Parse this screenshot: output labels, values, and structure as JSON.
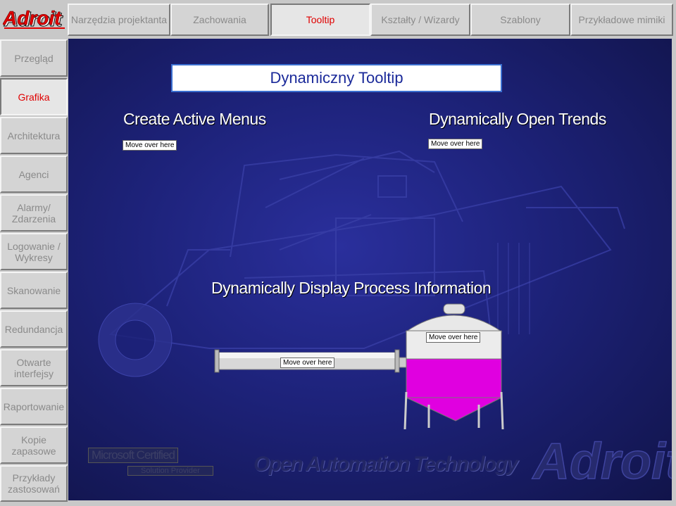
{
  "brand": {
    "logo_text": "Adroit"
  },
  "top_tabs": [
    {
      "label": "Narzędzia projektanta",
      "active": false
    },
    {
      "label": "Zachowania",
      "active": false
    },
    {
      "label": "Tooltip",
      "active": true
    },
    {
      "label": "Kształty / Wizardy",
      "active": false
    },
    {
      "label": "Szablony",
      "active": false
    },
    {
      "label": "Przykładowe mimiki",
      "active": false
    }
  ],
  "side_nav": [
    {
      "label": "Przegląd",
      "active": false
    },
    {
      "label": "Grafika",
      "active": true
    },
    {
      "label": "Architektura",
      "active": false
    },
    {
      "label": "Agenci",
      "active": false
    },
    {
      "label": "Alarmy/\nZdarzenia",
      "active": false
    },
    {
      "label": "Logowanie /\nWykresy",
      "active": false
    },
    {
      "label": "Skanowanie",
      "active": false
    },
    {
      "label": "Redundancja",
      "active": false
    },
    {
      "label": "Otwarte\ninterfejsy",
      "active": false
    },
    {
      "label": "Raportowanie",
      "active": false
    },
    {
      "label": "Kopie\nzapasowe",
      "active": false
    },
    {
      "label": "Przykłady\nzastosowań",
      "active": false
    }
  ],
  "main": {
    "title": "Dynamiczny Tooltip",
    "heading_menus": "Create Active Menus",
    "heading_trends": "Dynamically Open Trends",
    "heading_process": "Dynamically Display Process Information",
    "hover_menus": "Move over here",
    "hover_trends": "Move over here",
    "hover_tank": "Move over here",
    "hover_pipe": "Move over here"
  },
  "footer": {
    "ms_certified": "Microsoft Certified",
    "solution_provider": "Solution Provider",
    "tagline": "Open Automation Technology",
    "watermark_logo": "Adroit"
  },
  "colors": {
    "tank_fill": "#e000e0",
    "panel_blue": "#1d2279",
    "active_tab_text": "#e00000"
  }
}
